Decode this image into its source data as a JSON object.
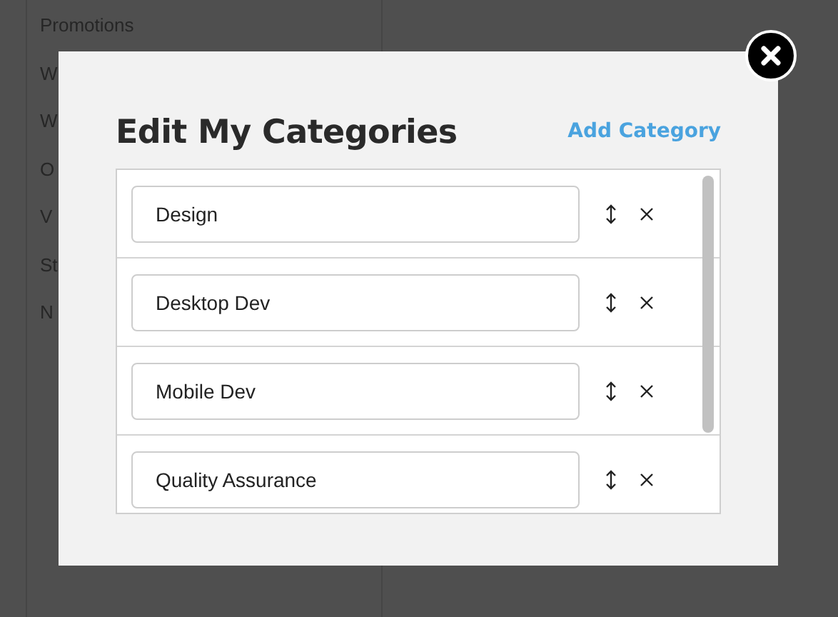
{
  "sidebar": {
    "items": [
      {
        "label": "Promotions"
      },
      {
        "label": "W"
      },
      {
        "label": "W"
      },
      {
        "label": "O"
      },
      {
        "label": "V"
      },
      {
        "label": "St"
      },
      {
        "label": "N"
      }
    ]
  },
  "modal": {
    "title": "Edit My Categories",
    "add_link": "Add Category",
    "categories": [
      {
        "value": "Design"
      },
      {
        "value": "Desktop Dev"
      },
      {
        "value": "Mobile Dev"
      },
      {
        "value": "Quality Assurance"
      }
    ]
  }
}
